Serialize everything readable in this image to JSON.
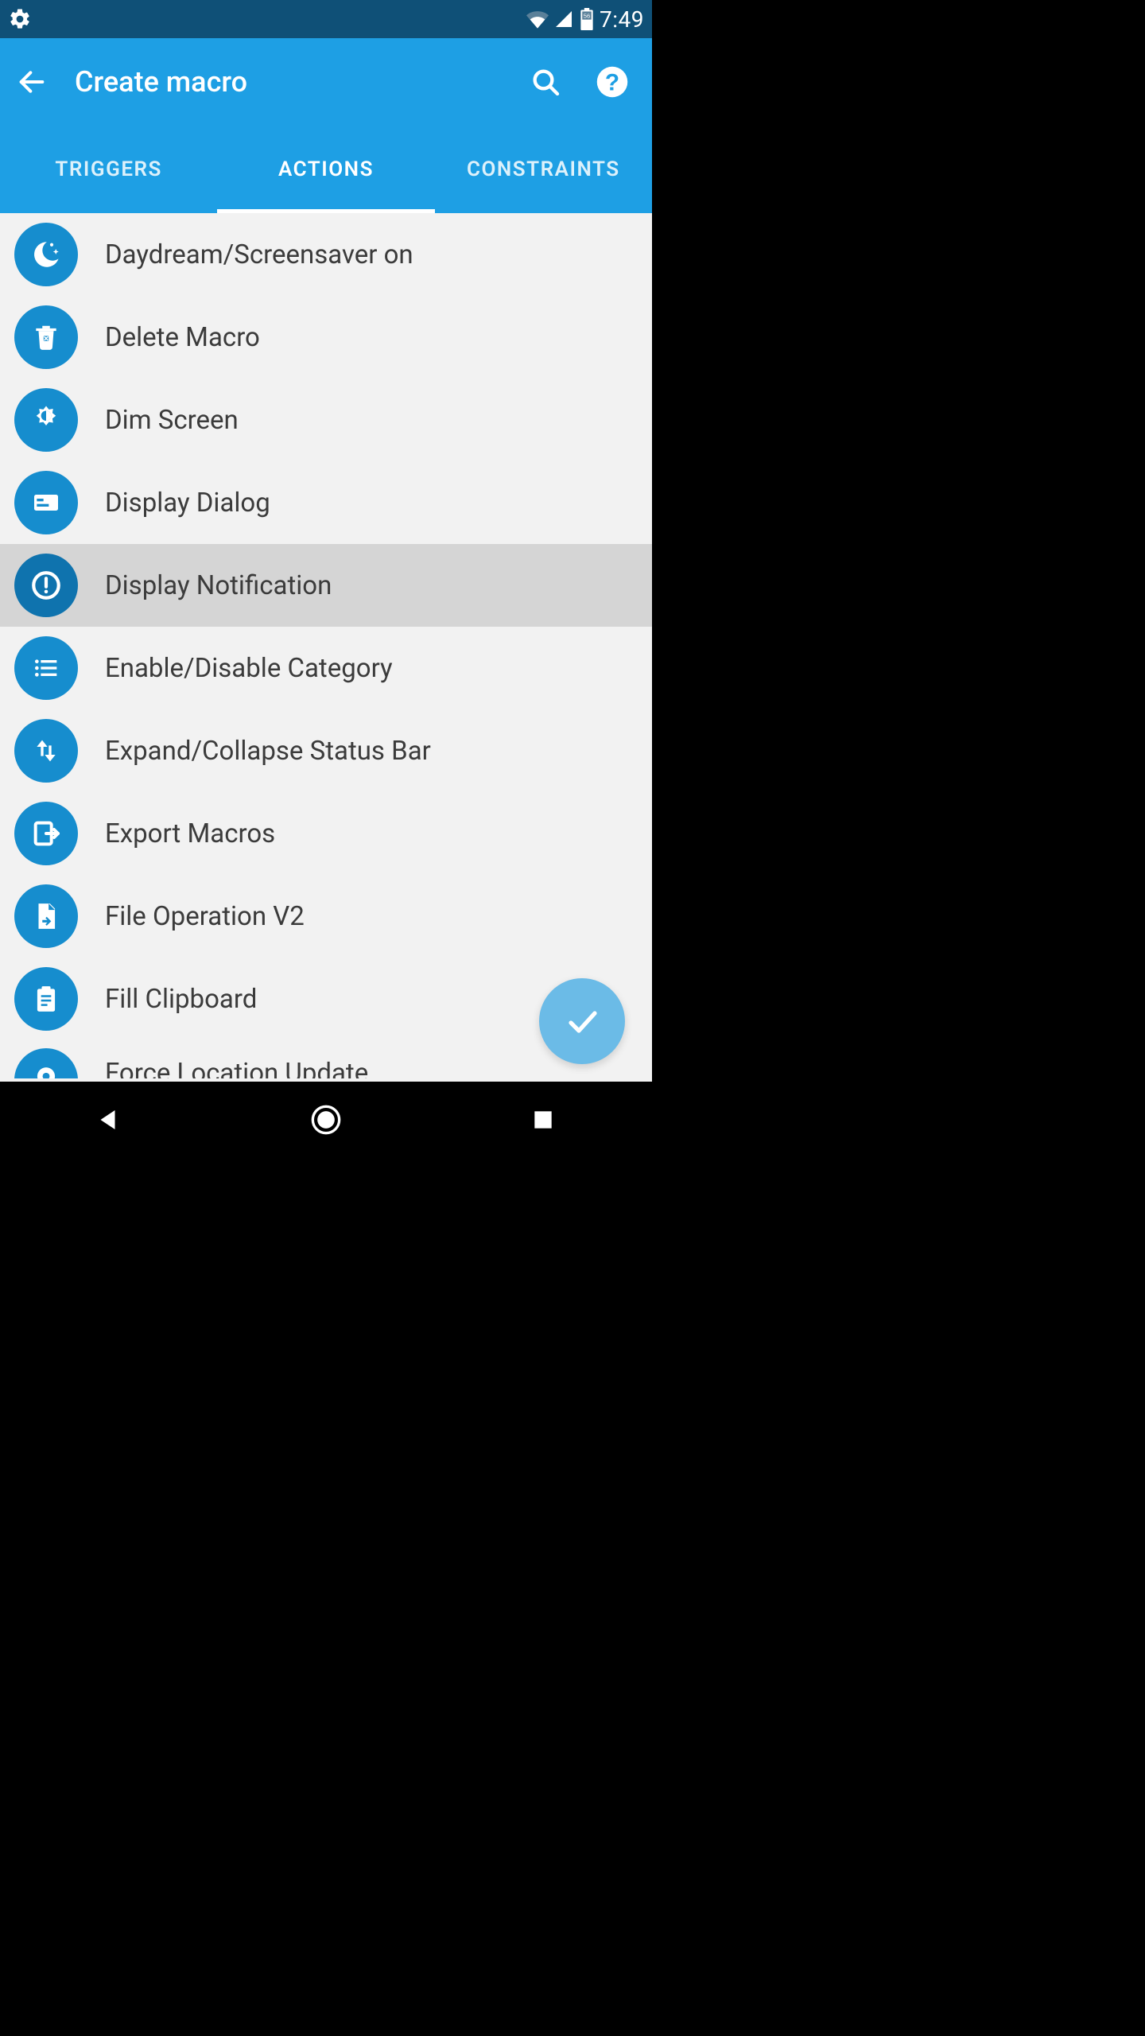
{
  "status": {
    "time": "7:49",
    "battery_text": "56"
  },
  "header": {
    "title": "Create macro"
  },
  "tabs": {
    "triggers": "TRIGGERS",
    "actions": "ACTIONS",
    "constraints": "CONSTRAINTS"
  },
  "actions_list": [
    {
      "label": "Daydream/Screensaver on",
      "icon": "moon-stars-icon",
      "selected": false
    },
    {
      "label": "Delete Macro",
      "icon": "trash-icon",
      "selected": false
    },
    {
      "label": "Dim Screen",
      "icon": "brightness-icon",
      "selected": false
    },
    {
      "label": "Display Dialog",
      "icon": "card-icon",
      "selected": false
    },
    {
      "label": "Display Notification",
      "icon": "alert-circle-icon",
      "selected": true
    },
    {
      "label": "Enable/Disable Category",
      "icon": "list-icon",
      "selected": false
    },
    {
      "label": "Expand/Collapse Status Bar",
      "icon": "swap-vertical-icon",
      "selected": false
    },
    {
      "label": "Export Macros",
      "icon": "export-icon",
      "selected": false
    },
    {
      "label": "File Operation V2",
      "icon": "file-arrow-icon",
      "selected": false
    },
    {
      "label": "Fill Clipboard",
      "icon": "clipboard-icon",
      "selected": false
    },
    {
      "label": "Force Location Update",
      "icon": "location-icon",
      "selected": false
    }
  ],
  "colors": {
    "status_bar": "#0f5077",
    "app_bar": "#1e9fe4",
    "icon_circle": "#168dce",
    "icon_circle_selected": "#0f73ae",
    "row_selected": "#d5d5d5",
    "list_bg": "#f2f2f2",
    "fab": "#6bbbe7"
  }
}
